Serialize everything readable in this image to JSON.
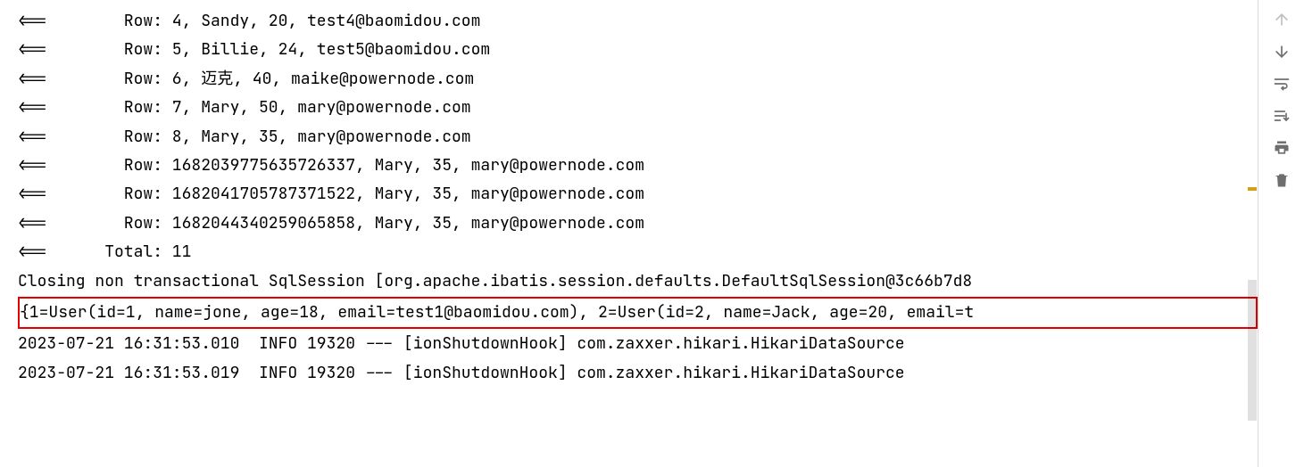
{
  "console": {
    "lines": [
      "<==        Row: 4, Sandy, 20, test4@baomidou.com",
      "<==        Row: 5, Billie, 24, test5@baomidou.com",
      "<==        Row: 6, 迈克, 40, maike@powernode.com",
      "<==        Row: 7, Mary, 50, mary@powernode.com",
      "<==        Row: 8, Mary, 35, mary@powernode.com",
      "<==        Row: 1682039775635726337, Mary, 35, mary@powernode.com",
      "<==        Row: 1682041705787371522, Mary, 35, mary@powernode.com",
      "<==        Row: 1682044340259065858, Mary, 35, mary@powernode.com",
      "<==      Total: 11",
      "Closing non transactional SqlSession [org.apache.ibatis.session.defaults.DefaultSqlSession@3c66b7d8"
    ],
    "highlighted_line": "{1=User(id=1, name=jone, age=18, email=test1@baomidou.com), 2=User(id=2, name=Jack, age=20, email=t",
    "after_lines": [
      "2023-07-21 16:31:53.010  INFO 19320 --- [ionShutdownHook] com.zaxxer.hikari.HikariDataSource",
      "2023-07-21 16:31:53.019  INFO 19320 --- [ionShutdownHook] com.zaxxer.hikari.HikariDataSource"
    ]
  },
  "gutter": {
    "icons": [
      {
        "name": "arrow-up-icon",
        "enabled": false
      },
      {
        "name": "arrow-down-icon",
        "enabled": true
      },
      {
        "name": "soft-wrap-icon",
        "enabled": true
      },
      {
        "name": "scroll-to-end-icon",
        "enabled": true
      },
      {
        "name": "print-icon",
        "enabled": true
      },
      {
        "name": "trash-icon",
        "enabled": true
      }
    ]
  },
  "scrollbar": {
    "thumb_top_pct": 60,
    "thumb_height_pct": 30,
    "warn_marker_top_pct": 40
  },
  "colors": {
    "highlight_border": "#e60000",
    "icon_default": "#6e6e6e",
    "icon_disabled": "#bfbfbf"
  }
}
